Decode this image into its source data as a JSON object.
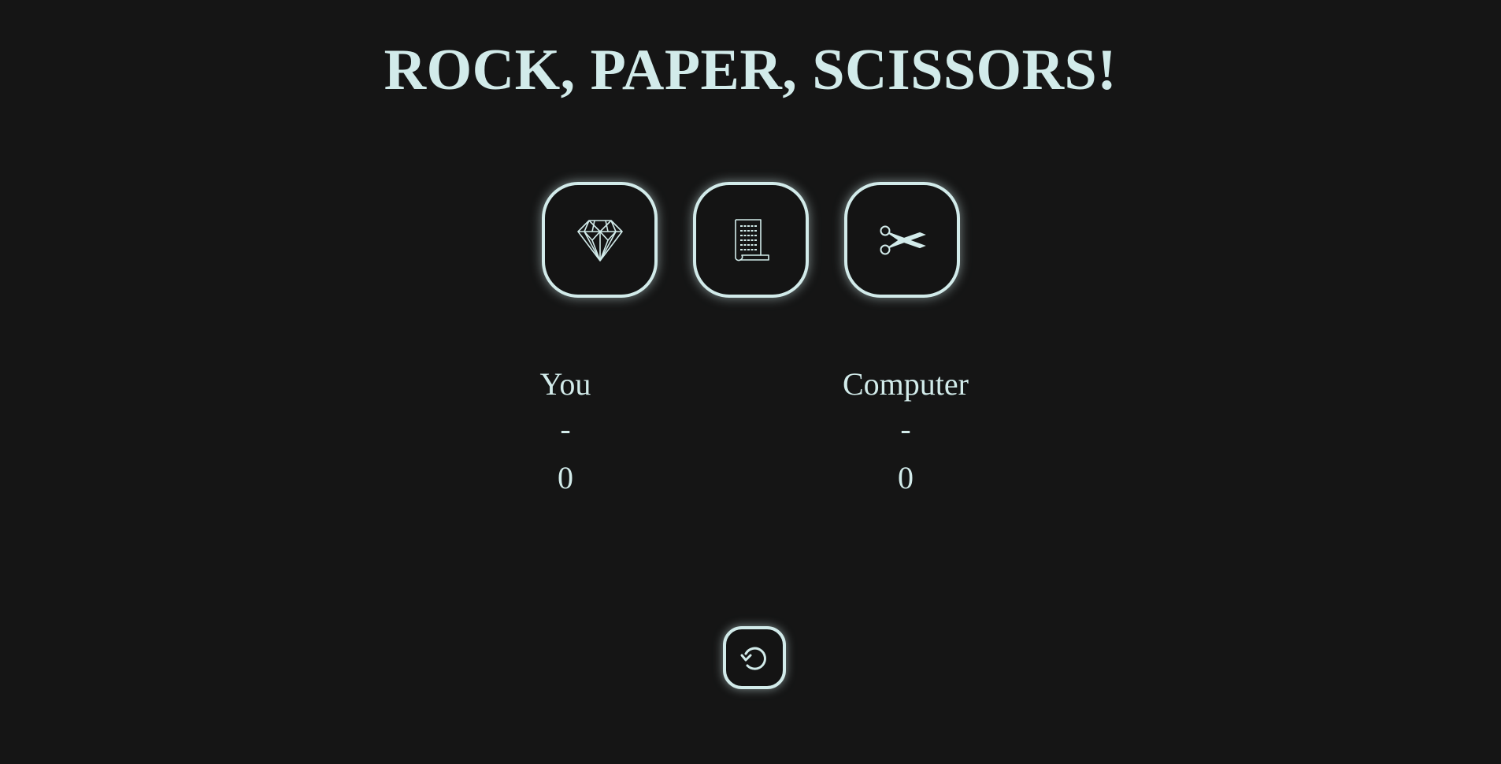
{
  "title": "ROCK, PAPER, SCISSORS!",
  "choices": [
    {
      "name": "rock",
      "icon": "gem-icon"
    },
    {
      "name": "paper",
      "icon": "scroll-icon"
    },
    {
      "name": "scissors",
      "icon": "scissors-icon"
    }
  ],
  "players": {
    "you": {
      "label": "You",
      "pick": "-",
      "score": "0"
    },
    "computer": {
      "label": "Computer",
      "pick": "-",
      "score": "0"
    }
  },
  "reset": {
    "icon": "refresh-icon"
  },
  "colors": {
    "background": "#151515",
    "foreground": "#d2ebea"
  }
}
